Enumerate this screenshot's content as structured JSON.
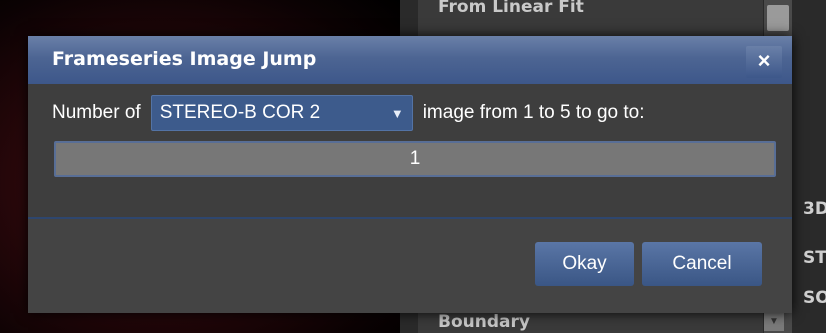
{
  "background": {
    "list_items": [
      "From Linear Fit",
      "Boundary"
    ],
    "right_labels": [
      "3D",
      "ST",
      "SO"
    ]
  },
  "dialog": {
    "title": "Frameseries Image Jump",
    "close_symbol": "×",
    "prompt_prefix": "Number of",
    "dropdown_value": "STEREO-B COR 2",
    "dropdown_arrow": "▼",
    "prompt_suffix": "image from 1 to 5 to go to:",
    "input_value": "1",
    "okay_label": "Okay",
    "cancel_label": "Cancel"
  },
  "colors": {
    "titlebar": "#4d6593",
    "button": "#4a66a0",
    "dialog_bg": "#3e3e3e"
  }
}
